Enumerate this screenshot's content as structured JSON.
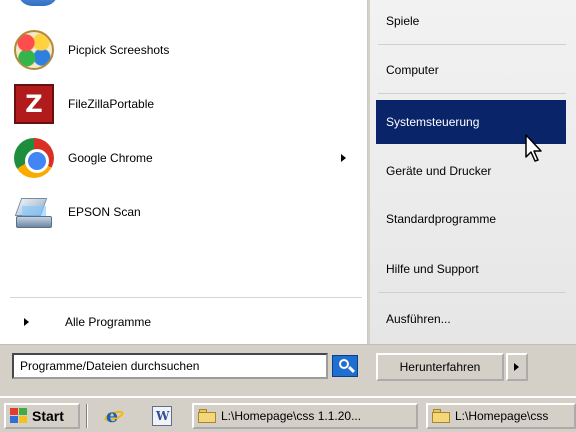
{
  "left_panel": {
    "programs": [
      {
        "label": "Picpick Screeshots",
        "icon": "picpick-icon"
      },
      {
        "label": "FileZillaPortable",
        "icon": "filezilla-icon"
      },
      {
        "label": "Google Chrome",
        "icon": "chrome-icon",
        "has_submenu": true
      },
      {
        "label": "EPSON Scan",
        "icon": "epson-scan-icon"
      }
    ],
    "all_programs_label": "Alle Programme"
  },
  "right_panel": {
    "items": [
      {
        "label": "Spiele"
      },
      {
        "label": "Computer"
      },
      {
        "label": "Systemsteuerung",
        "highlighted": true
      },
      {
        "label": "Geräte und Drucker"
      },
      {
        "label": "Standardprogramme"
      },
      {
        "label": "Hilfe und Support"
      },
      {
        "label": "Ausführen..."
      }
    ]
  },
  "search": {
    "value": "Programme/Dateien durchsuchen"
  },
  "shutdown": {
    "label": "Herunterfahren"
  },
  "taskbar": {
    "start_label": "Start",
    "tasks": [
      {
        "label": "L:\\Homepage\\css 1.1.20..."
      },
      {
        "label": "L:\\Homepage\\css"
      }
    ]
  },
  "colors": {
    "highlight": "#0a246a",
    "menu_background": "#ffffff",
    "chrome": "#d4d0c8"
  }
}
